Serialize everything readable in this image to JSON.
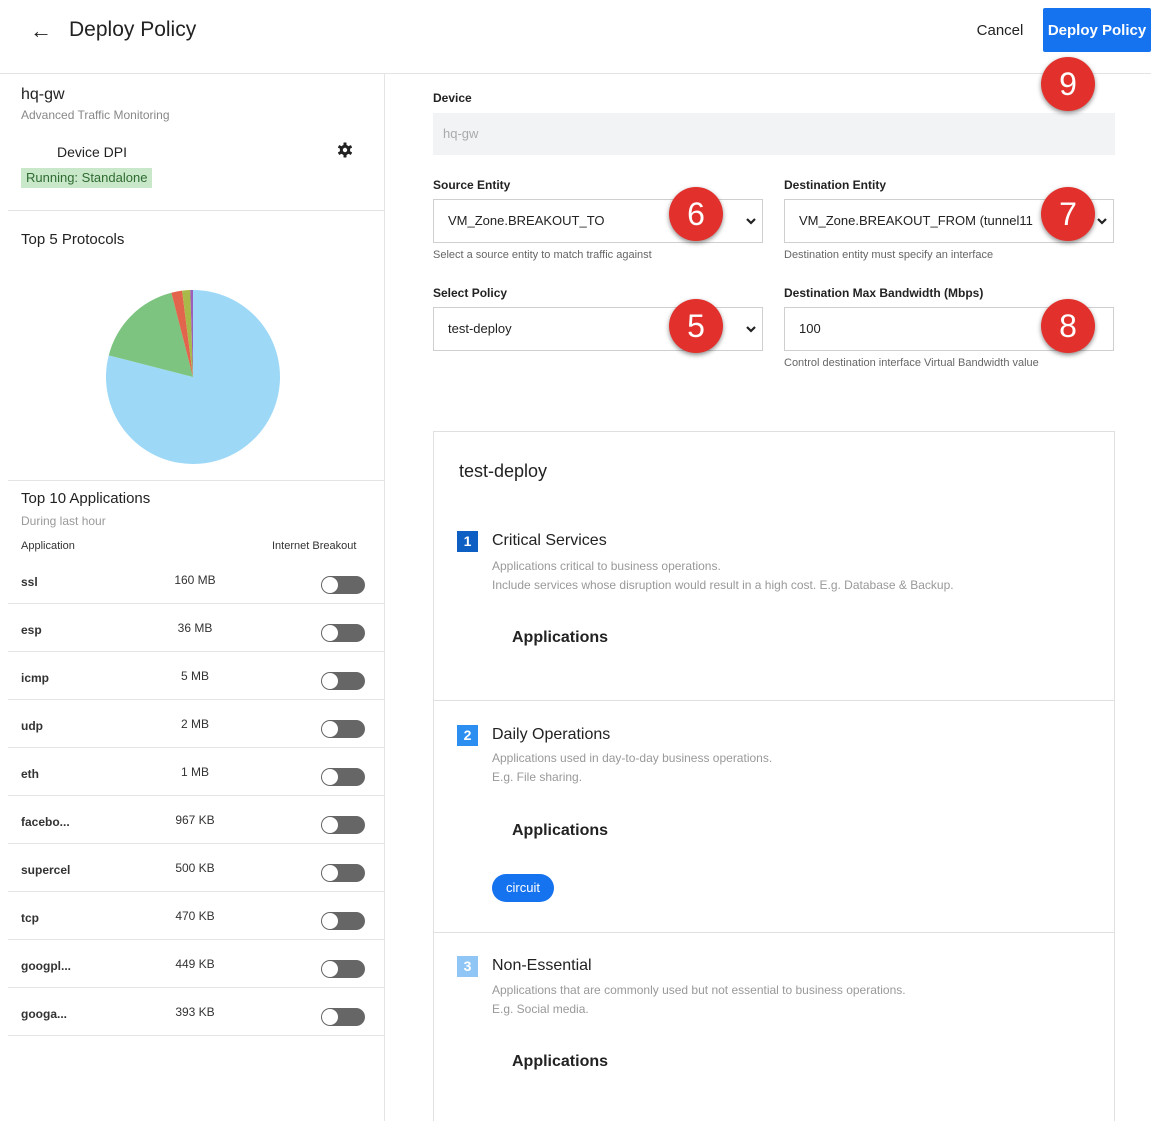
{
  "header": {
    "back_icon": "back-arrow-icon",
    "title": "Deploy Policy",
    "cancel_label": "Cancel",
    "deploy_label": "Deploy Policy"
  },
  "device_panel": {
    "name": "hq-gw",
    "subtitle": "Advanced Traffic Monitoring",
    "dpi_label": "Device DPI",
    "status": "Running: Standalone"
  },
  "protocols": {
    "title": "Top 5 Protocols"
  },
  "chart_data": {
    "type": "pie",
    "values": [
      79,
      17,
      2,
      1.5,
      0.5
    ],
    "colors": [
      "#9dd8f7",
      "#7cc47f",
      "#e3644d",
      "#a8b94a",
      "#9c5fbe"
    ]
  },
  "applications": {
    "title": "Top 10 Applications",
    "subtitle": "During last hour",
    "col_application": "Application",
    "col_breakout": "Internet Breakout",
    "rows": [
      {
        "name": "ssl",
        "size": "160 MB"
      },
      {
        "name": "esp",
        "size": "36 MB"
      },
      {
        "name": "icmp",
        "size": "5 MB"
      },
      {
        "name": "udp",
        "size": "2 MB"
      },
      {
        "name": "eth",
        "size": "1 MB"
      },
      {
        "name": "facebo...",
        "size": "967 KB"
      },
      {
        "name": "supercel",
        "size": "500 KB"
      },
      {
        "name": "tcp",
        "size": "470 KB"
      },
      {
        "name": "googpl...",
        "size": "449 KB"
      },
      {
        "name": "googa...",
        "size": "393 KB"
      }
    ]
  },
  "form": {
    "device_label": "Device",
    "device_value": "hq-gw",
    "source_label": "Source Entity",
    "source_value": "VM_Zone.BREAKOUT_TO",
    "source_help": "Select a source entity to match traffic against",
    "dest_label": "Destination Entity",
    "dest_value": "VM_Zone.BREAKOUT_FROM (tunnel11",
    "dest_help": "Destination entity must specify an interface",
    "policy_label": "Select Policy",
    "policy_value": "test-deploy",
    "bandwidth_label": "Destination Max Bandwidth (Mbps)",
    "bandwidth_value": "100",
    "bandwidth_help": "Control destination interface Virtual Bandwidth value"
  },
  "callouts": [
    "5",
    "6",
    "7",
    "8",
    "9"
  ],
  "policy": {
    "name": "test-deploy",
    "tiers": [
      {
        "number": "1",
        "title": "Critical Services",
        "desc1": "Applications critical to business operations.",
        "desc2": "Include services whose disruption would result in a high cost. E.g. Database & Backup.",
        "apps_label": "Applications"
      },
      {
        "number": "2",
        "title": "Daily Operations",
        "desc1": "Applications used in day-to-day business operations.",
        "desc2": "E.g. File sharing.",
        "apps_label": "Applications",
        "apps": [
          "circuit"
        ]
      },
      {
        "number": "3",
        "title": "Non-Essential",
        "desc1": "Applications that are commonly used but not essential to business operations.",
        "desc2": "E.g. Social media.",
        "apps_label": "Applications"
      }
    ]
  },
  "colors": {
    "primary": "#1673ef",
    "callout": "#e2312c",
    "tier1": "#0d5fc4",
    "tier2": "#2b8ef0",
    "tier3": "#8fc6f5",
    "status_bg": "#c8e8c9"
  }
}
